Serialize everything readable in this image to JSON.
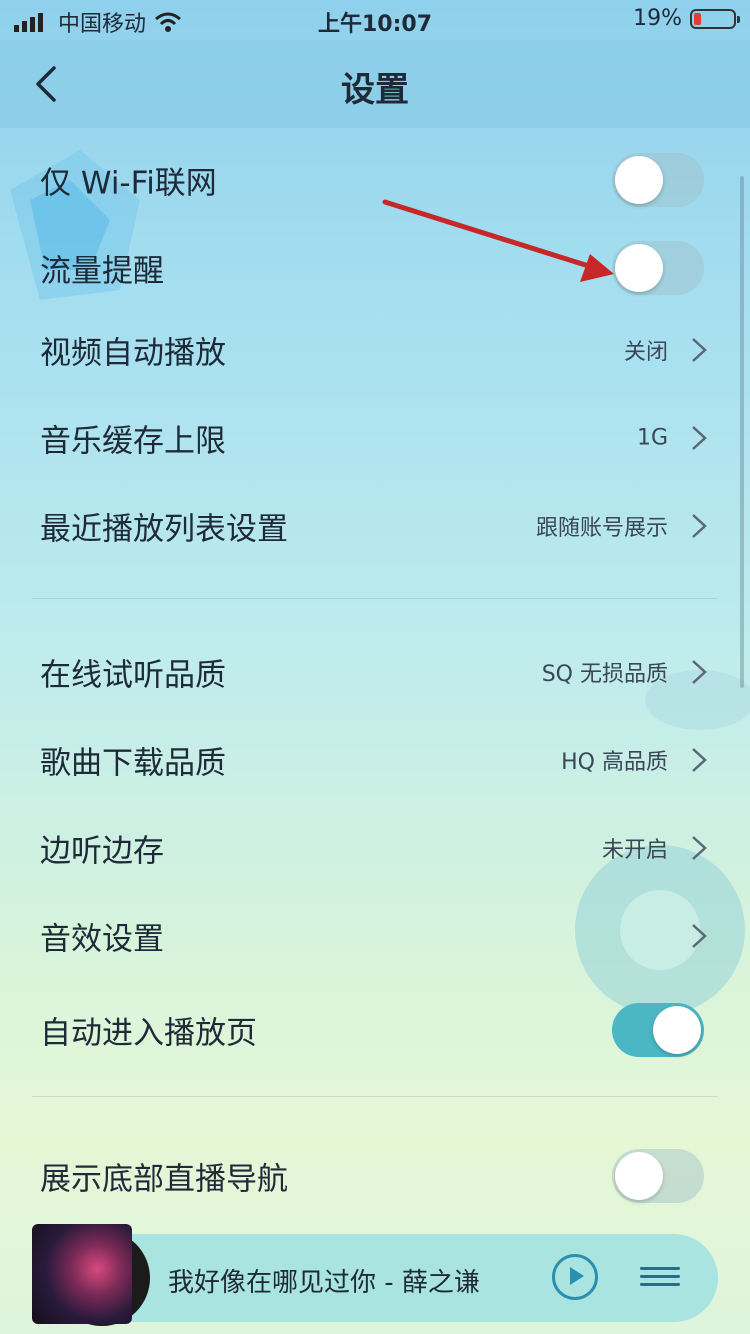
{
  "status_bar": {
    "carrier": "中国移动",
    "time": "上午10:07",
    "battery": "19%",
    "battery_level": 0.19
  },
  "header": {
    "title": "设置"
  },
  "rows": [
    {
      "label": "仅 Wi-Fi联网",
      "toggle": "off"
    },
    {
      "label": "流量提醒",
      "toggle": "off"
    },
    {
      "label": "视频自动播放",
      "value": "关闭"
    },
    {
      "label": "音乐缓存上限",
      "value": "1G"
    },
    {
      "label": "最近播放列表设置",
      "value": "跟随账号展示"
    },
    {
      "label": "在线试听品质",
      "value": "SQ 无损品质"
    },
    {
      "label": "歌曲下载品质",
      "value": "HQ 高品质"
    },
    {
      "label": "边听边存",
      "value": "未开启"
    },
    {
      "label": "音效设置",
      "value": ""
    },
    {
      "label": "自动进入播放页",
      "toggle": "on"
    },
    {
      "label": "展示底部直播导航",
      "toggle": "off"
    }
  ],
  "player": {
    "song": "我好像在哪见过你 - 薛之谦"
  },
  "colors": {
    "accent": "#4bb6c4",
    "arrow": "#c62828",
    "battery_low": "#e23b3b"
  }
}
